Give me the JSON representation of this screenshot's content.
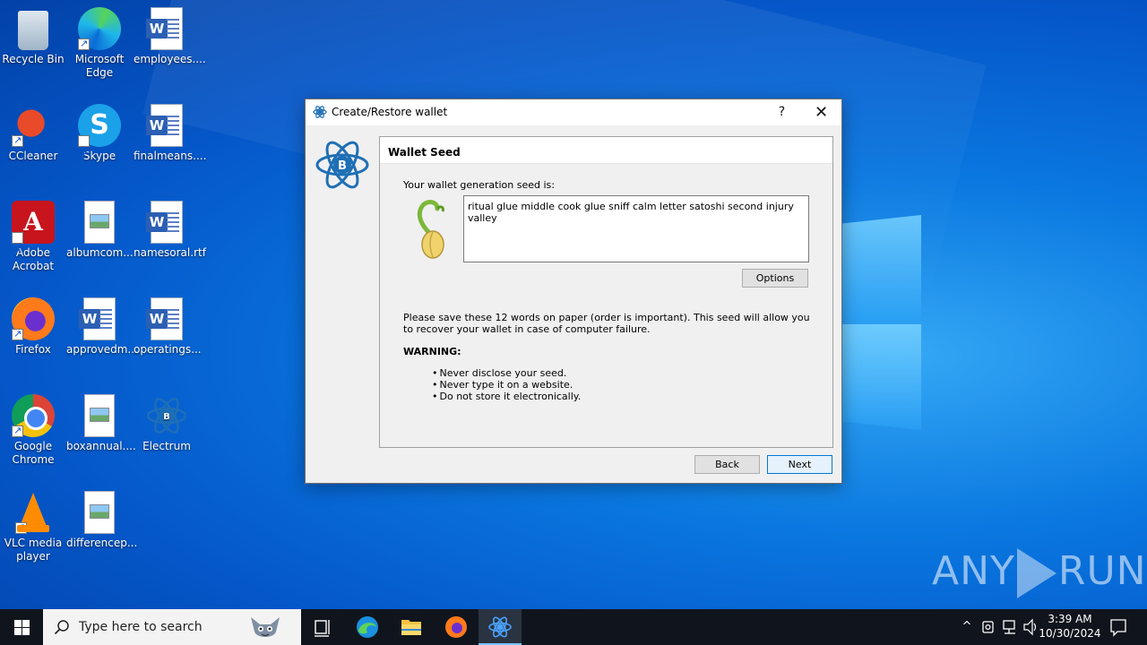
{
  "desktop": {
    "icons": [
      {
        "label": "Recycle Bin"
      },
      {
        "label": "Microsoft Edge"
      },
      {
        "label": "employees...."
      },
      {
        "label": "CCleaner"
      },
      {
        "label": "Skype"
      },
      {
        "label": "finalmeans...."
      },
      {
        "label": "Adobe Acrobat"
      },
      {
        "label": "albumcom..."
      },
      {
        "label": "namesoral.rtf"
      },
      {
        "label": "Firefox"
      },
      {
        "label": "approvedm..."
      },
      {
        "label": "operatings..."
      },
      {
        "label": "Google Chrome"
      },
      {
        "label": "boxannual...."
      },
      {
        "label": "Electrum"
      },
      {
        "label": "VLC media player"
      },
      {
        "label": "differencep..."
      }
    ]
  },
  "dialog": {
    "title": "Create/Restore wallet",
    "help_glyph": "?",
    "close_glyph": "✕",
    "panel_title": "Wallet Seed",
    "seed_label": "Your wallet generation seed is:",
    "seed_text": "ritual glue middle cook glue sniff calm letter satoshi second injury valley",
    "options_label": "Options",
    "save_note": "Please save these 12 words on paper (order is important). This seed will allow you to recover your wallet in case of computer failure.",
    "warning_label": "WARNING:",
    "bullets": [
      "Never disclose your seed.",
      "Never type it on a website.",
      "Do not store it electronically."
    ],
    "back_label": "Back",
    "next_label": "Next"
  },
  "watermark": {
    "left": "ANY",
    "right": "RUN"
  },
  "taskbar": {
    "search_placeholder": "Type here to search",
    "time": "3:39 AM",
    "date": "10/30/2024"
  },
  "colors": {
    "accent": "#0078d7",
    "desktop": "#0a78e0",
    "electrum_blue": "#1f6fb5"
  }
}
